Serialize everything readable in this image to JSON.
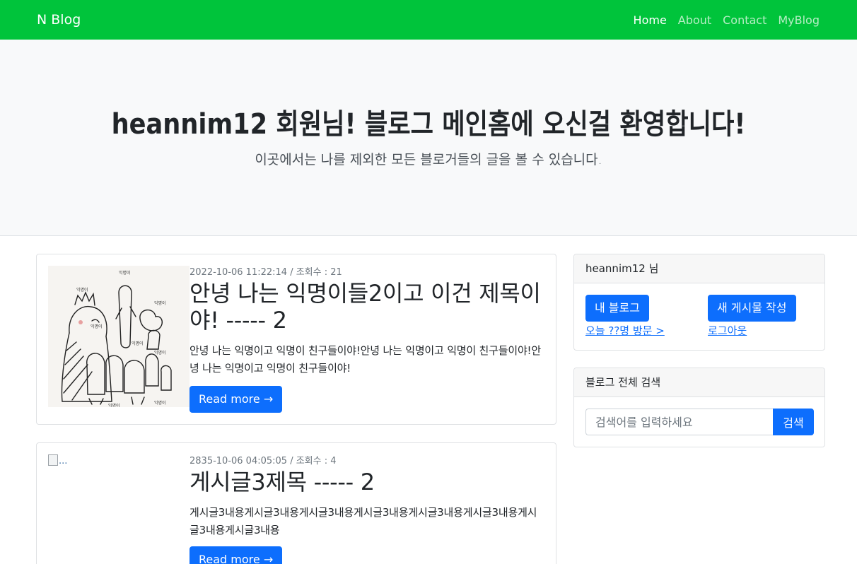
{
  "colors": {
    "navbar_bg": "#00c43b",
    "primary": "#0d6efd",
    "hero_bg": "#f8f9fa",
    "nav_active": "#ffffff",
    "nav_inactive": "#b7eec5"
  },
  "navbar": {
    "brand": "N Blog",
    "links": [
      {
        "label": "Home",
        "active": true
      },
      {
        "label": "About",
        "active": false
      },
      {
        "label": "Contact",
        "active": false
      },
      {
        "label": "MyBlog",
        "active": false
      }
    ]
  },
  "hero": {
    "title": "heannim12 회원님! 블로그 메인홈에 오신걸 환영합니다!",
    "subtitle": "이곳에서는 나를 제외한 모든 블로거들의 글을 볼 수 있습니다."
  },
  "posts": [
    {
      "meta": "2022-10-06 11:22:14 / 조회수 : 21",
      "title": "안녕 나는 익명이들2이고 이건 제목이야! ----- 2",
      "text": "안녕 나는 익명이고 익명이 친구들이야!안녕 나는 익명이고 익명이 친구들이야!안녕 나는 익명이고 익명이 친구들이야!",
      "image": "doodle-drawing",
      "read_more": "Read more →"
    },
    {
      "meta": "2835-10-06 04:05:05 / 조회수 : 4",
      "title": "게시글3제목 ----- 2",
      "text": "게시글3내용게시글3내용게시글3내용게시글3내용게시글3내용게시글3내용게시글3내용게시글3내용",
      "image_alt": "...",
      "read_more": "Read more →"
    }
  ],
  "sidebar": {
    "user_card": {
      "header": "heannim12 님",
      "my_blog_button": "내 블로그",
      "new_post_button": "새 게시물 작성",
      "visitors_link": "오늘 ??명 방문 >",
      "logout_link": "로그아웃"
    },
    "search_card": {
      "header": "블로그 전체 검색",
      "placeholder": "검색어를 입력하세요",
      "button": "검색"
    }
  }
}
